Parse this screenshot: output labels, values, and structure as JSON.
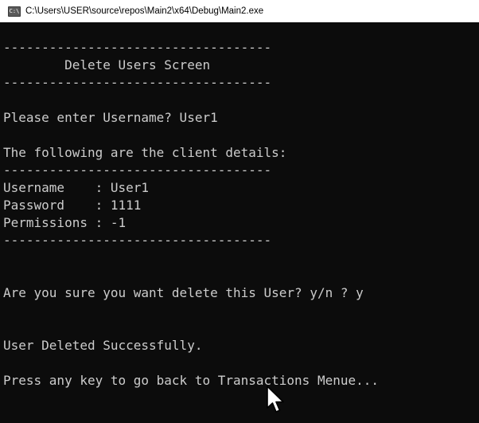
{
  "window": {
    "title": "C:\\Users\\USER\\source\\repos\\Main2\\x64\\Debug\\Main2.exe",
    "icon": "console-app-icon",
    "icon_glyph": "C:\\"
  },
  "console": {
    "lines": [
      "-----------------------------------",
      "        Delete Users Screen",
      "-----------------------------------",
      "Please enter Username? User1",
      "The following are the client details:",
      "-----------------------------------",
      "Username    : User1",
      "Password    : 1111",
      "Permissions : -1",
      "-----------------------------------",
      "Are you sure you want delete this User? y/n ? y",
      "User Deleted Successfully.",
      "Press any key to go back to Transactions Menue..."
    ]
  },
  "colors": {
    "console_background": "#0c0c0c",
    "console_text": "#cccccc",
    "titlebar_background": "#ffffff"
  }
}
